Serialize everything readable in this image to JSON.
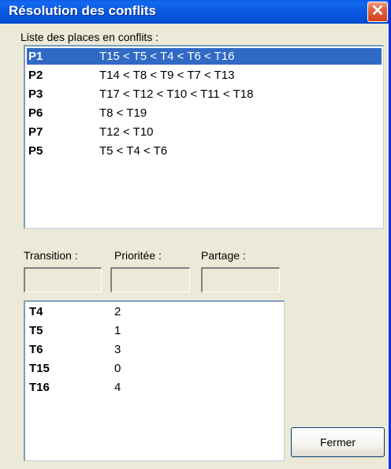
{
  "window": {
    "title": "Résolution des conflits",
    "close_symbol": "✕"
  },
  "places": {
    "label": "Liste des places en conflits :",
    "items": [
      {
        "name": "P1",
        "sequence": "T15 < T5 < T4 < T6 < T16",
        "selected": true
      },
      {
        "name": "P2",
        "sequence": "T14 < T8 < T9 < T7 < T13",
        "selected": false
      },
      {
        "name": "P3",
        "sequence": "T17 < T12 < T10 < T11 < T18",
        "selected": false
      },
      {
        "name": "P6",
        "sequence": "T8 < T19",
        "selected": false
      },
      {
        "name": "P7",
        "sequence": "T12 < T10",
        "selected": false
      },
      {
        "name": "P5",
        "sequence": "T5 < T4 < T6",
        "selected": false
      }
    ]
  },
  "fields": {
    "transition_label": "Transition :",
    "priority_label": "Prioritée :",
    "share_label": "Partage :",
    "transition_value": "",
    "priority_value": "",
    "share_value": ""
  },
  "transitions": {
    "items": [
      {
        "name": "T4",
        "priority": "2"
      },
      {
        "name": "T5",
        "priority": "1"
      },
      {
        "name": "T6",
        "priority": "3"
      },
      {
        "name": "T15",
        "priority": "0"
      },
      {
        "name": "T16",
        "priority": "4"
      }
    ]
  },
  "buttons": {
    "close_label": "Fermer"
  },
  "colors": {
    "titlebar": "#0a58df",
    "selection": "#316ac5",
    "close_button": "#e3623e"
  }
}
